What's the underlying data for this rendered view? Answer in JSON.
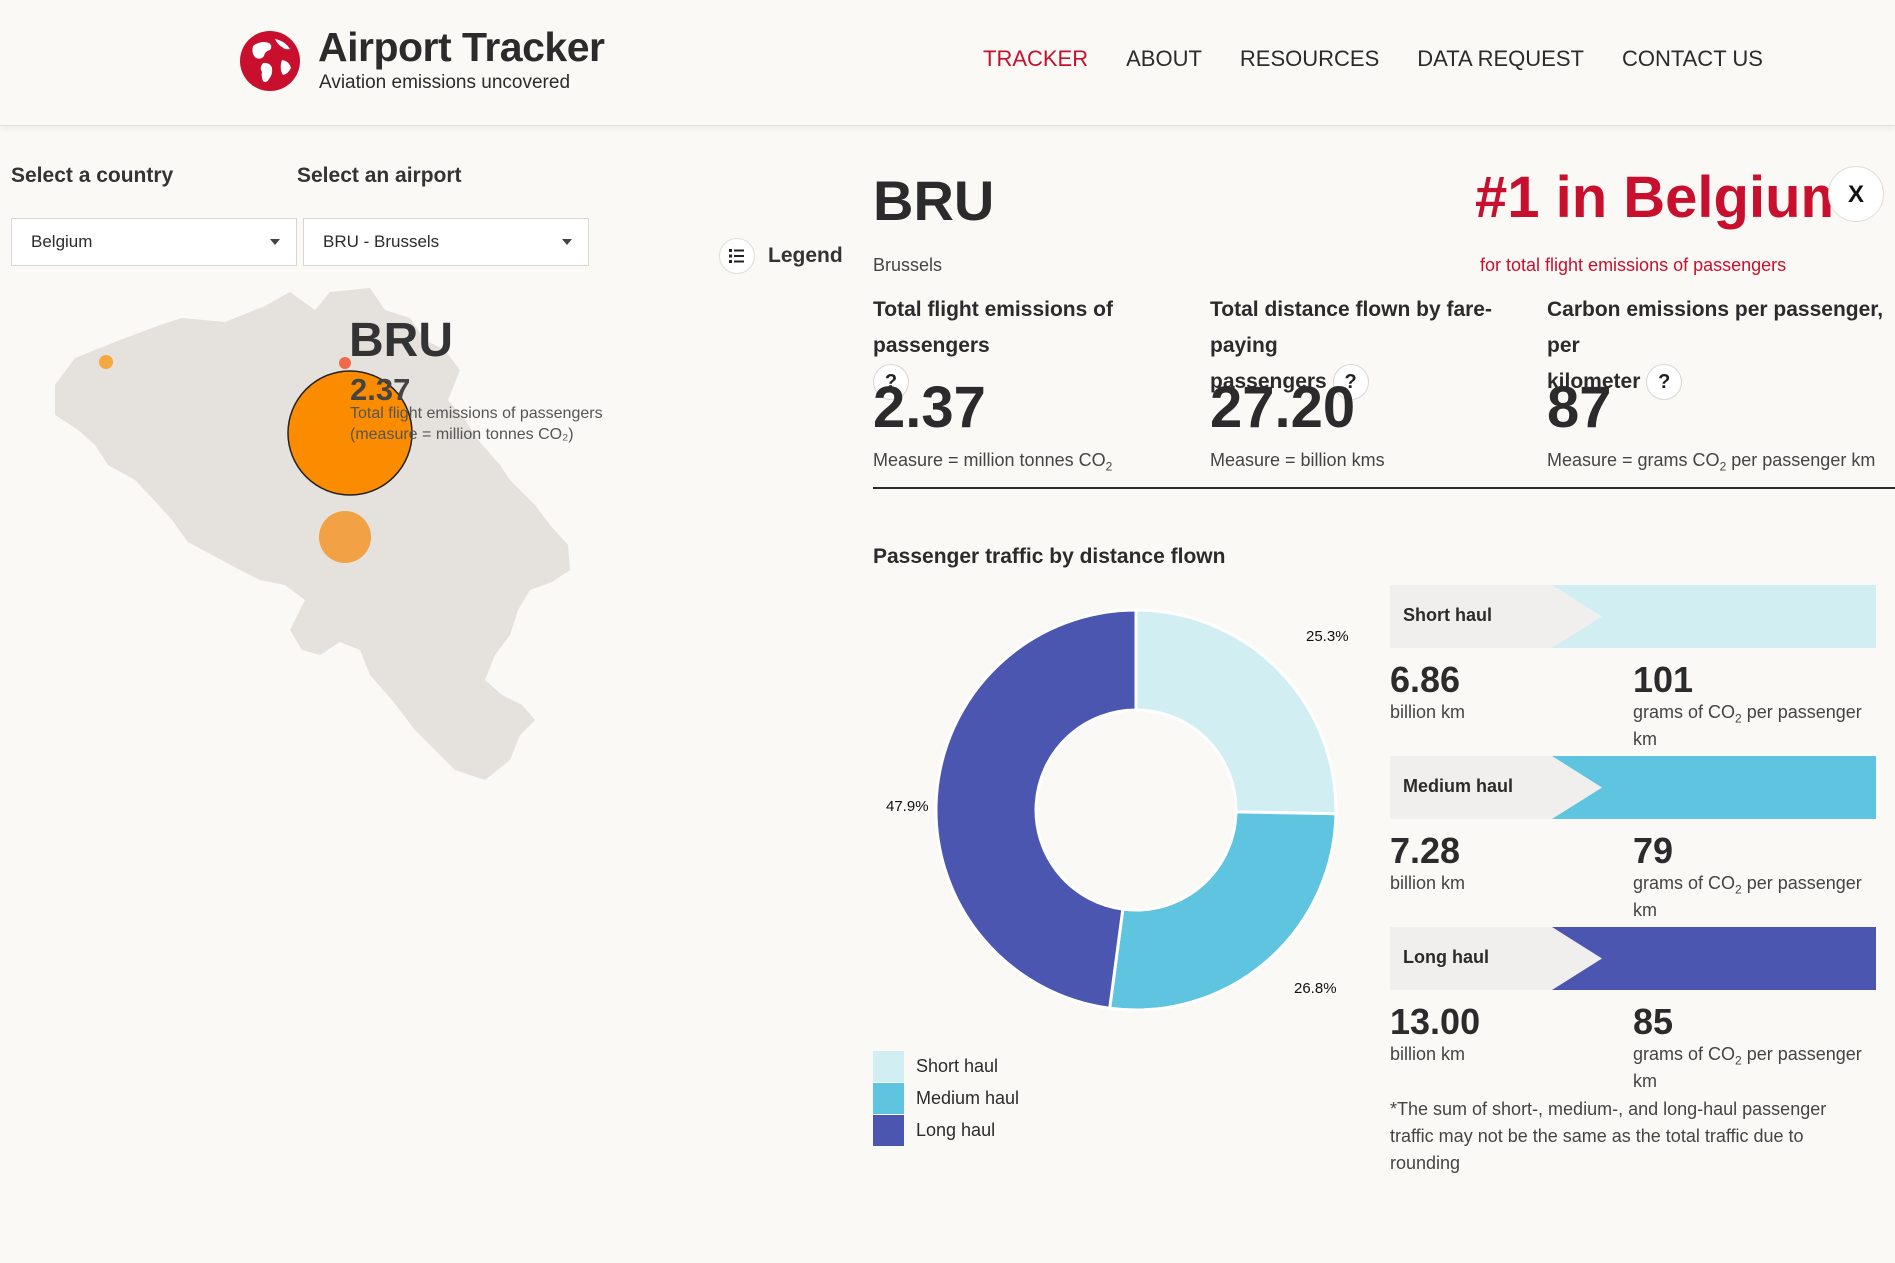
{
  "brand": {
    "title": "Airport Tracker",
    "subtitle": "Aviation emissions uncovered",
    "accent": "#c8102e"
  },
  "nav": [
    {
      "label": "TRACKER",
      "active": true
    },
    {
      "label": "ABOUT",
      "active": false
    },
    {
      "label": "RESOURCES",
      "active": false
    },
    {
      "label": "DATA REQUEST",
      "active": false
    },
    {
      "label": "CONTACT US",
      "active": false
    }
  ],
  "filters": {
    "country_label": "Select a country",
    "country_value": "Belgium",
    "airport_label": "Select an airport",
    "airport_value": "BRU - Brussels",
    "legend_label": "Legend"
  },
  "map": {
    "code": "BRU",
    "value": "2.37",
    "desc_line1": "Total flight emissions of passengers",
    "desc_line2": "(measure = million tonnes CO₂)"
  },
  "airport": {
    "code": "BRU",
    "city": "Brussels",
    "rank": "#1 in Belgium",
    "rank_sub": "for total flight emissions of passengers",
    "close": "X"
  },
  "metrics": [
    {
      "label": "Total flight emissions of passengers",
      "value": "2.37",
      "measure_pre": "Measure = million tonnes CO",
      "measure_sub": "2",
      "measure_post": ""
    },
    {
      "label_a": "Total distance flown by fare-paying",
      "label_b": "passengers",
      "value": "27.20",
      "measure_pre": "Measure = billion kms",
      "measure_sub": "",
      "measure_post": ""
    },
    {
      "label_a": "Carbon emissions per passenger, per",
      "label_b": "kilometer",
      "value": "87",
      "measure_pre": "Measure = grams CO",
      "measure_sub": "2",
      "measure_post": " per passenger km"
    }
  ],
  "help_glyph": "?",
  "traffic": {
    "title": "Passenger traffic by distance flown",
    "chart_data": {
      "type": "pie",
      "categories": [
        "Short haul",
        "Medium haul",
        "Long haul"
      ],
      "values": [
        25.3,
        26.8,
        47.9
      ],
      "labels": [
        "25.3%",
        "26.8%",
        "47.9%"
      ],
      "colors": [
        "#d1eef3",
        "#5fc4df",
        "#4b56b0"
      ]
    },
    "hauls": [
      {
        "name": "Short haul",
        "distance": "6.86",
        "distance_unit": "billion km",
        "intensity": "101",
        "intensity_unit_pre": "grams of CO",
        "intensity_unit_sub": "2",
        "intensity_unit_post": " per passenger",
        "intensity_unit_line2": "km",
        "color": "#d1eef3"
      },
      {
        "name": "Medium haul",
        "distance": "7.28",
        "distance_unit": "billion km",
        "intensity": "79",
        "intensity_unit_pre": "grams of CO",
        "intensity_unit_sub": "2",
        "intensity_unit_post": " per passenger",
        "intensity_unit_line2": "km",
        "color": "#5fc4df"
      },
      {
        "name": "Long haul",
        "distance": "13.00",
        "distance_unit": "billion km",
        "intensity": "85",
        "intensity_unit_pre": "grams of CO",
        "intensity_unit_sub": "2",
        "intensity_unit_post": " per passenger",
        "intensity_unit_line2": "km",
        "color": "#4b56b0"
      }
    ],
    "footnote": "*The sum of short-, medium-, and long-haul passenger traffic may not be the same as the total traffic due to rounding"
  }
}
